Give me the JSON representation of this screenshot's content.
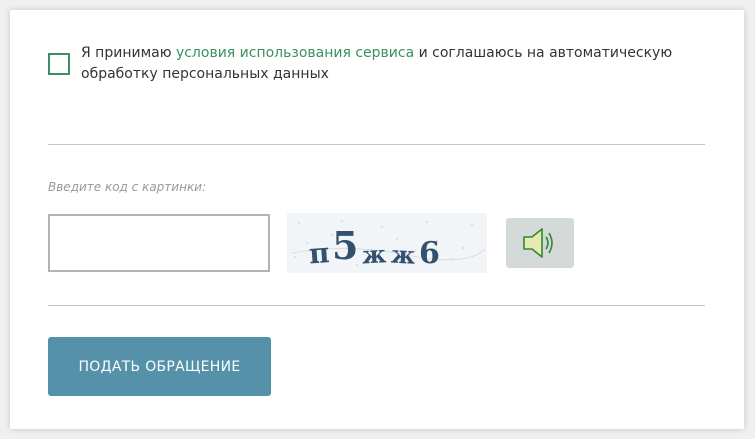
{
  "consent": {
    "text_before": "Я принимаю ",
    "link_text": "условия использования сервиса",
    "text_after": " и соглашаюсь на автоматическую обработку персональных данных",
    "checked": false,
    "link_color": "#3a8f63"
  },
  "captcha": {
    "label": "Введите код с картинки:",
    "input_value": "",
    "image_text": "п5жж6",
    "audio_icon": "speaker-icon"
  },
  "submit": {
    "label": "ПОДАТЬ ОБРАЩЕНИЕ",
    "color": "#5591a9"
  }
}
